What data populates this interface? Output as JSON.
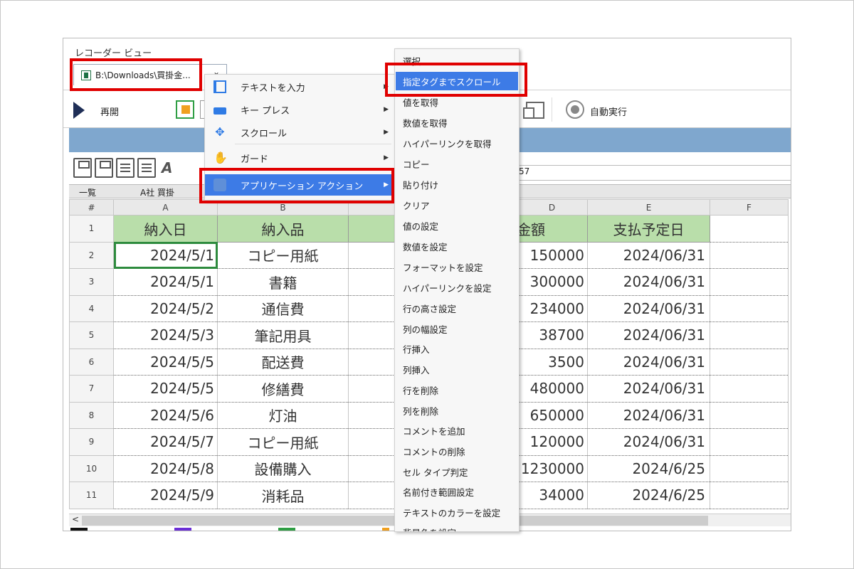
{
  "window": {
    "title": "レコーダー ビュー"
  },
  "tab": {
    "label": "B:\\Downloads\\買掛金...",
    "chevron": "⌄"
  },
  "toolbar": {
    "resume": "再開",
    "auto_run": "自動実行"
  },
  "spreadsheet": {
    "sheet_name_left": "一覧",
    "sheet_name_right": "A社 買掛",
    "formula_fragment": "57",
    "ss_font_glyph": "A",
    "columns": [
      "#",
      "A",
      "B",
      "C",
      "D",
      "E",
      "F"
    ],
    "header_row": {
      "num": "1",
      "a": "納入日",
      "b": "納入品",
      "c": "",
      "d": "金額",
      "e": "支払予定日"
    },
    "rows": [
      {
        "num": "2",
        "a": "2024/5/1",
        "b": "コピー用紙",
        "d": "150000",
        "e": "2024/06/31"
      },
      {
        "num": "3",
        "a": "2024/5/1",
        "b": "書籍",
        "d": "300000",
        "e": "2024/06/31"
      },
      {
        "num": "4",
        "a": "2024/5/2",
        "b": "通信費",
        "d": "234000",
        "e": "2024/06/31"
      },
      {
        "num": "5",
        "a": "2024/5/3",
        "b": "筆記用具",
        "d": "38700",
        "e": "2024/06/31"
      },
      {
        "num": "6",
        "a": "2024/5/5",
        "b": "配送費",
        "d": "3500",
        "e": "2024/06/31"
      },
      {
        "num": "7",
        "a": "2024/5/5",
        "b": "修繕費",
        "d": "480000",
        "e": "2024/06/31"
      },
      {
        "num": "8",
        "a": "2024/5/6",
        "b": "灯油",
        "d": "650000",
        "e": "2024/06/31"
      },
      {
        "num": "9",
        "a": "2024/5/7",
        "b": "コピー用紙",
        "d": "120000",
        "e": "2024/06/31"
      },
      {
        "num": "10",
        "a": "2024/5/8",
        "b": "設備購入",
        "d": "1230000",
        "e": "2024/6/25"
      },
      {
        "num": "11",
        "a": "2024/5/9",
        "b": "消耗品",
        "d": "34000",
        "e": "2024/6/25"
      }
    ],
    "scroll_left_glyph": "<"
  },
  "context_menu": {
    "items": [
      {
        "label": "テキストを入力",
        "icon": "text-input-icon",
        "arrow": "▶"
      },
      {
        "label": "キー プレス",
        "icon": "keyboard-icon",
        "arrow": "▶"
      },
      {
        "label": "スクロール",
        "icon": "move-icon",
        "arrow": "▶"
      },
      {
        "label": "ガード",
        "icon": "hand-icon",
        "arrow": "▶"
      },
      {
        "label": "アプリケーション アクション",
        "icon": "app-icon",
        "arrow": "▶"
      }
    ]
  },
  "submenu": {
    "items": [
      "選択",
      "指定タグまでスクロール",
      "値を取得",
      "数値を取得",
      "ハイパーリンクを取得",
      "コピー",
      "貼り付け",
      "クリア",
      "値の設定",
      "数値を設定",
      "フォーマットを設定",
      "ハイパーリンクを設定",
      "行の高さ設定",
      "列の幅設定",
      "行挿入",
      "列挿入",
      "行を削除",
      "列を削除",
      "コメントを追加",
      "コメントの削除",
      "セル タイプ判定",
      "名前付き範囲設定",
      "テキストのカラーを設定",
      "背景色を設定"
    ]
  },
  "colors": {
    "highlight": "#3d7be6",
    "header_green": "#b9deaa",
    "annotation_red": "#e00000",
    "band_blue": "#7fa7ce"
  }
}
